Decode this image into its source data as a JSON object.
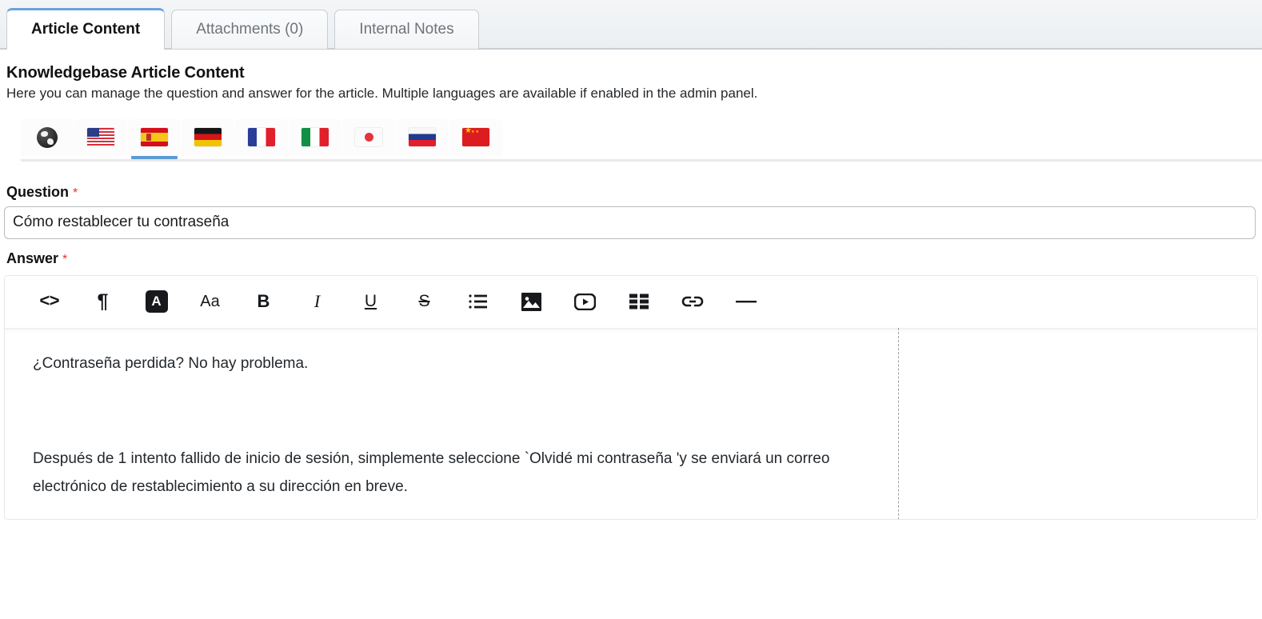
{
  "tabs": [
    {
      "label": "Article Content",
      "active": true
    },
    {
      "label": "Attachments (0)",
      "active": false
    },
    {
      "label": "Internal Notes",
      "active": false
    }
  ],
  "section": {
    "title": "Knowledgebase Article Content",
    "subtitle": "Here you can manage the question and answer for the article. Multiple languages are available if enabled in the admin panel."
  },
  "languages": [
    {
      "name": "default-global",
      "icon": "globe-icon",
      "active": false
    },
    {
      "name": "english-us",
      "icon": "flag-us-icon",
      "active": false
    },
    {
      "name": "spanish",
      "icon": "flag-es-icon",
      "active": true
    },
    {
      "name": "german",
      "icon": "flag-de-icon",
      "active": false
    },
    {
      "name": "french",
      "icon": "flag-fr-icon",
      "active": false
    },
    {
      "name": "italian",
      "icon": "flag-it-icon",
      "active": false
    },
    {
      "name": "japanese",
      "icon": "flag-jp-icon",
      "active": false
    },
    {
      "name": "russian",
      "icon": "flag-ru-icon",
      "active": false
    },
    {
      "name": "chinese",
      "icon": "flag-cn-icon",
      "active": false
    }
  ],
  "question": {
    "label": "Question",
    "required_marker": "*",
    "value": "Cómo restablecer tu contraseña",
    "placeholder": ""
  },
  "answer": {
    "label": "Answer",
    "required_marker": "*",
    "toolbar": [
      {
        "name": "source-code-icon",
        "label": "<>"
      },
      {
        "name": "paragraph-format-icon",
        "label": "¶"
      },
      {
        "name": "text-color-icon",
        "label": "A"
      },
      {
        "name": "font-size-icon",
        "label": "Aa"
      },
      {
        "name": "bold-icon",
        "label": "B"
      },
      {
        "name": "italic-icon",
        "label": "I"
      },
      {
        "name": "underline-icon",
        "label": "U"
      },
      {
        "name": "strikethrough-icon",
        "label": "S"
      },
      {
        "name": "bullet-list-icon",
        "label": ""
      },
      {
        "name": "insert-image-icon",
        "label": ""
      },
      {
        "name": "insert-video-icon",
        "label": ""
      },
      {
        "name": "insert-table-icon",
        "label": ""
      },
      {
        "name": "insert-link-icon",
        "label": ""
      },
      {
        "name": "horizontal-rule-icon",
        "label": ""
      }
    ],
    "paragraphs": [
      "¿Contraseña perdida? No hay problema.",
      "Después de 1 intento fallido de inicio de sesión, simplemente seleccione `Olvidé mi contraseña 'y se enviará un correo electrónico de restablecimiento a su dirección en breve."
    ]
  },
  "colors": {
    "accent": "#5b9bd5",
    "required": "#e8342a",
    "toolbar_icon": "#17191c"
  }
}
